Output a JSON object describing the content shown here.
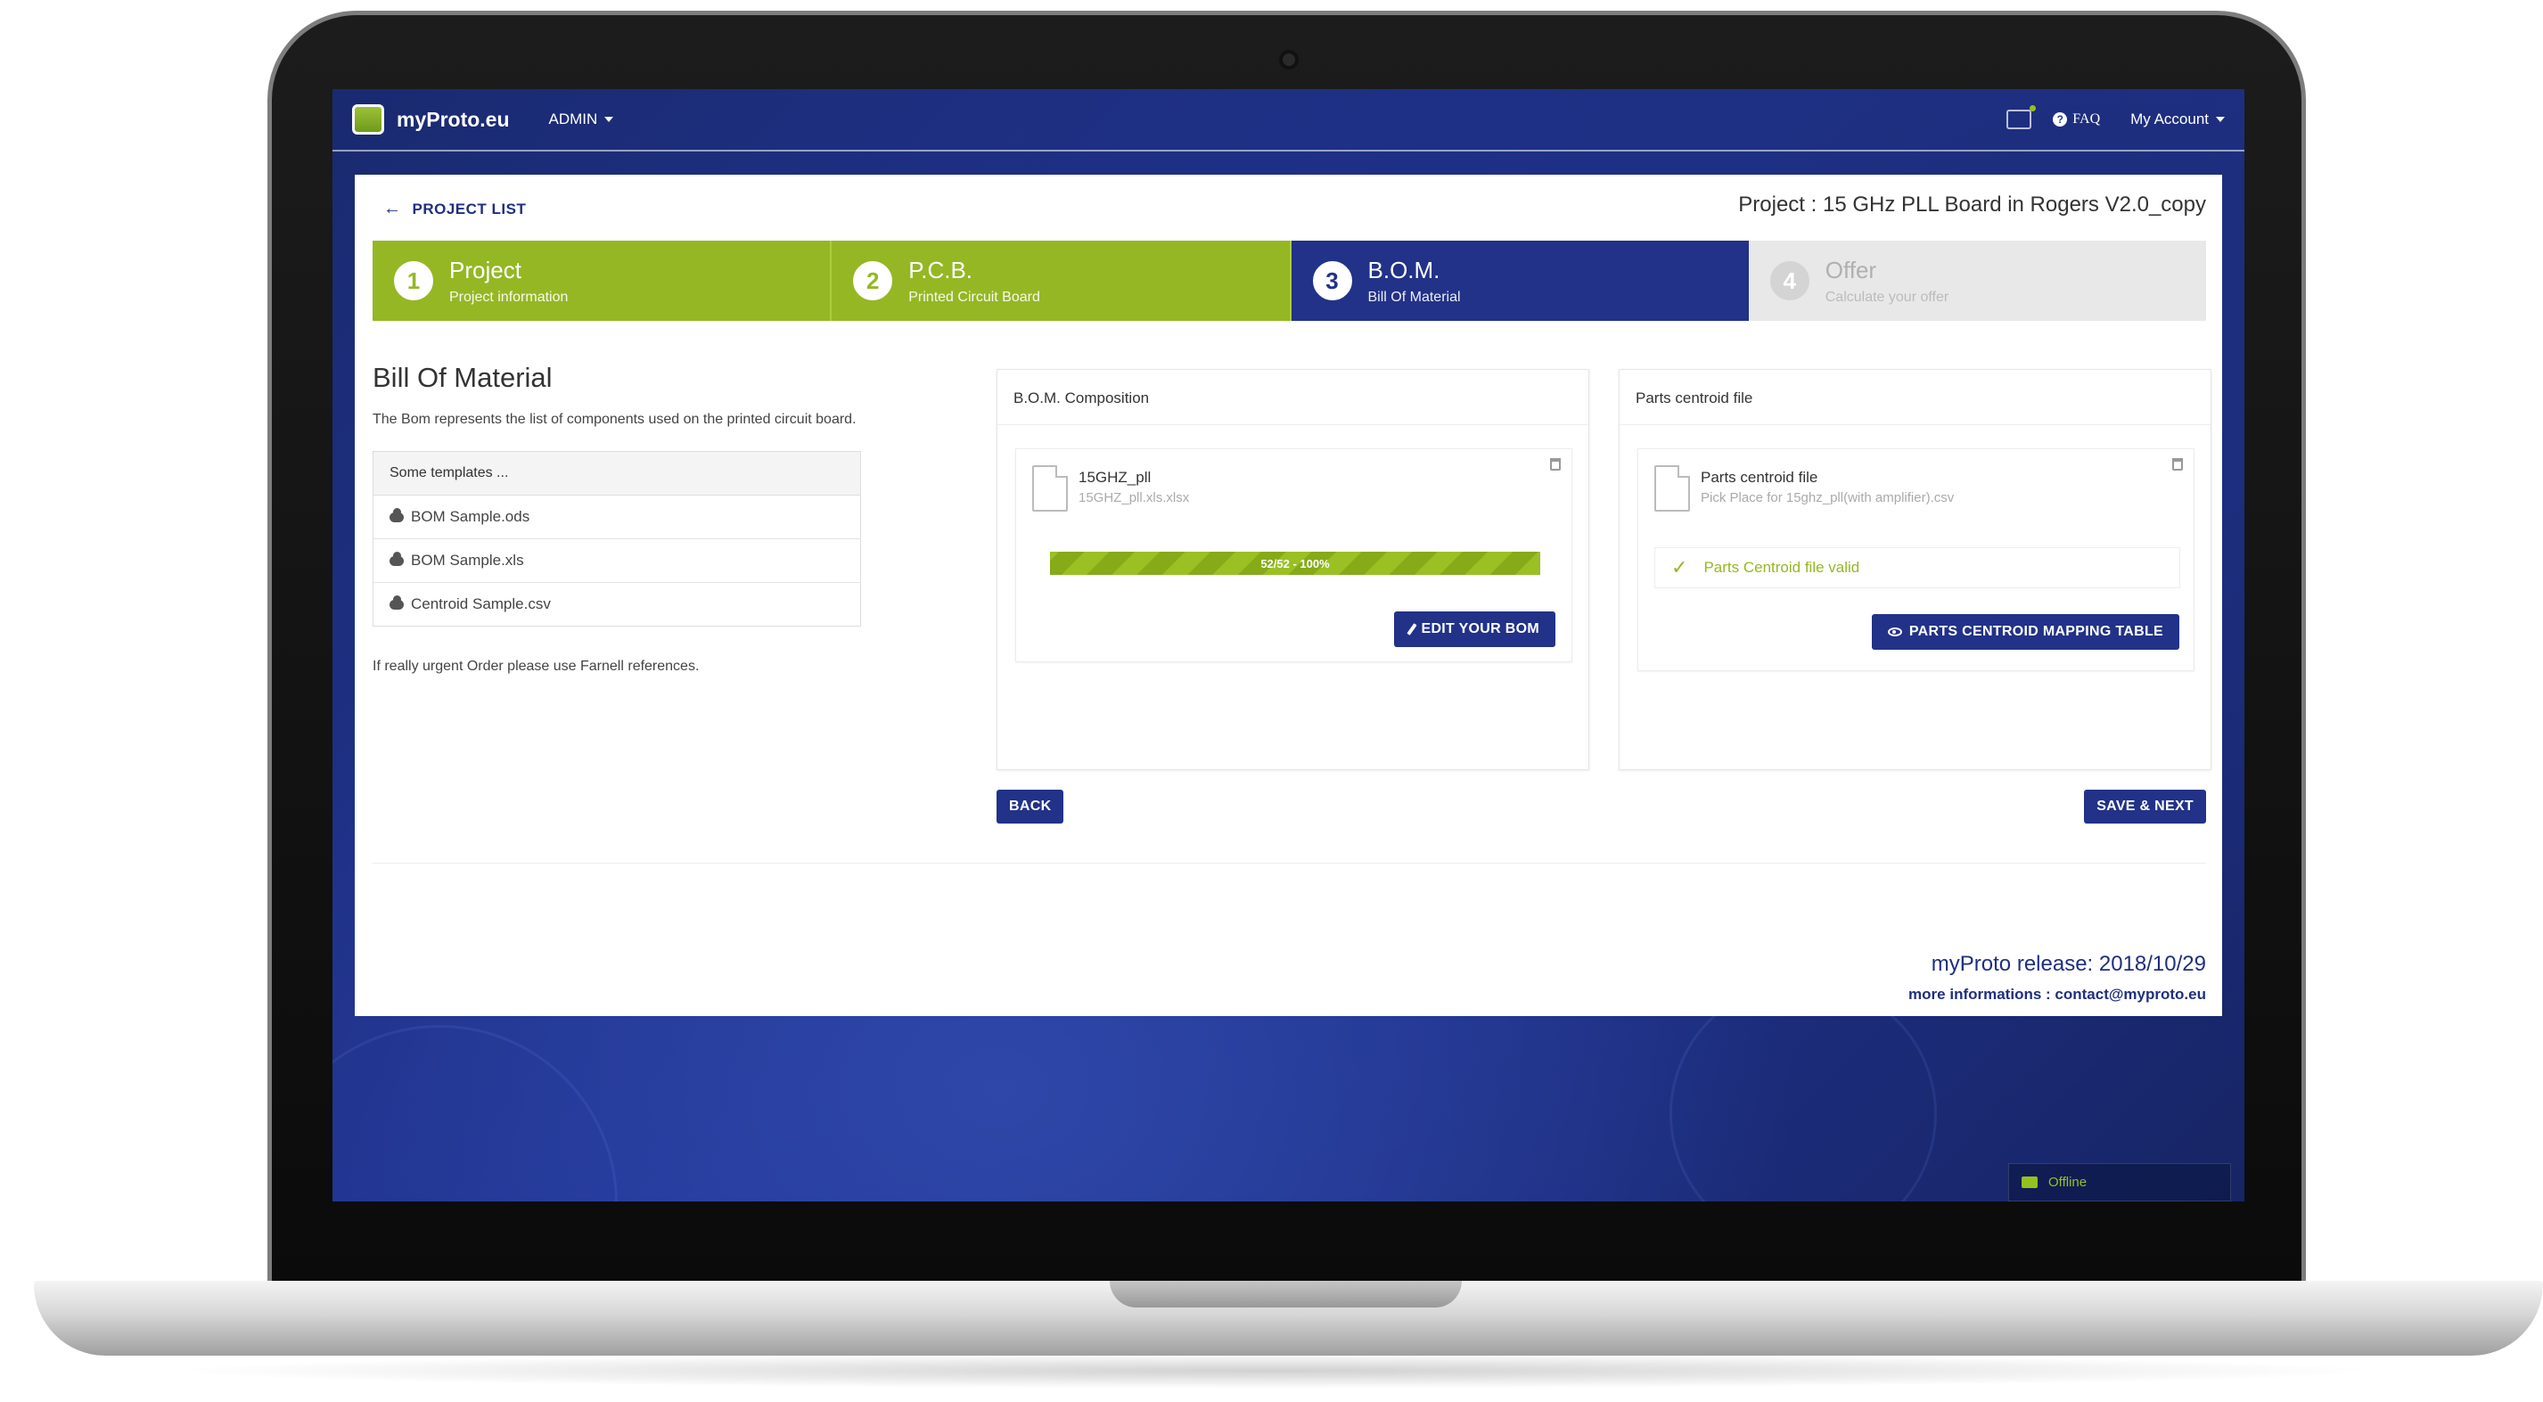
{
  "header": {
    "logo": "myProto.eu",
    "admin_menu": "ADMIN",
    "faq": "FAQ",
    "account": "My Account"
  },
  "nav": {
    "back_label": "PROJECT LIST",
    "project_title": "Project : 15 GHz PLL Board in Rogers V2.0_copy"
  },
  "steps": [
    {
      "num": "1",
      "title": "Project",
      "subtitle": "Project information",
      "state": "done"
    },
    {
      "num": "2",
      "title": "P.C.B.",
      "subtitle": "Printed Circuit Board",
      "state": "done"
    },
    {
      "num": "3",
      "title": "B.O.M.",
      "subtitle": "Bill Of Material",
      "state": "active"
    },
    {
      "num": "4",
      "title": "Offer",
      "subtitle": "Calculate your offer",
      "state": "pending"
    }
  ],
  "bom": {
    "heading": "Bill Of Material",
    "description": "The Bom represents the list of components used on the printed circuit board.",
    "templates_header": "Some templates ...",
    "templates": [
      "BOM Sample.ods",
      "BOM Sample.xls",
      "Centroid Sample.csv"
    ],
    "urgent_note": "If really urgent Order please use Farnell references."
  },
  "composition": {
    "title": "B.O.M. Composition",
    "file_name": "15GHZ_pll",
    "file_sub": "15GHZ_pll.xls.xlsx",
    "progress_label": "52/52 - 100%",
    "progress_percent": 100,
    "edit_button": "EDIT YOUR BOM"
  },
  "centroid": {
    "title": "Parts centroid file",
    "file_name": "Parts centroid file",
    "file_sub": "Pick Place for 15ghz_pll(with amplifier).csv",
    "valid_text": "Parts Centroid file valid",
    "mapping_button": "PARTS CENTROID MAPPING TABLE"
  },
  "actions": {
    "back": "BACK",
    "save_next": "SAVE & NEXT"
  },
  "footer": {
    "release": "myProto release: 2018/10/29",
    "more_info": "more informations : contact@myproto.eu"
  },
  "chat": {
    "status": "Offline"
  },
  "colors": {
    "accent_green": "#95b724",
    "primary_blue": "#213288"
  }
}
